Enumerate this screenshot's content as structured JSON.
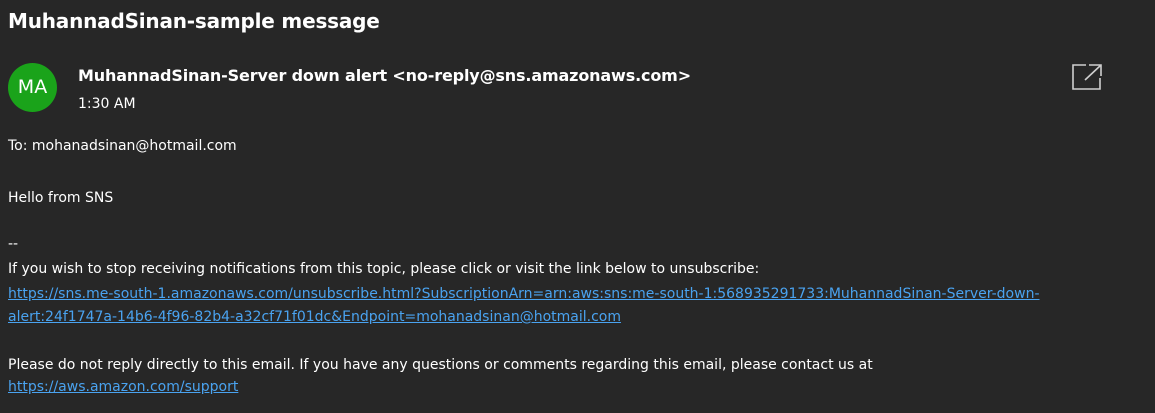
{
  "message": {
    "subject": "MuhannadSinan-sample message",
    "avatar_initials": "MA",
    "avatar_color": "#1aa31a",
    "sender": "MuhannadSinan-Server down alert <no-reply@sns.amazonaws.com>",
    "time": "1:30 AM",
    "to": "To: mohanadsinan@hotmail.com"
  },
  "toolbar": {
    "popout_icon": "open-in-new-window-icon"
  },
  "body": {
    "greeting": "Hello from SNS",
    "separator": "--",
    "unsubscribe_text": "If you wish to stop receiving notifications from this topic, please click or visit the link below to unsubscribe:",
    "unsubscribe_link_line1": "https://sns.me-south-1.amazonaws.com/unsubscribe.html?SubscriptionArn=arn:aws:sns:me-south-1:568935291733:MuhannadSinan-Server-down-",
    "unsubscribe_link_line2": "alert:24f1747a-14b6-4f96-82b4-a32cf71f01dc&Endpoint=mohanadsinan@hotmail.com",
    "noreply_text": "Please do not reply directly to this email. If you have any questions or comments regarding this email, please contact us at",
    "support_link": "https://aws.amazon.com/support"
  },
  "colors": {
    "background": "#272727",
    "text": "#ffffff",
    "link": "#4aa3f0"
  }
}
